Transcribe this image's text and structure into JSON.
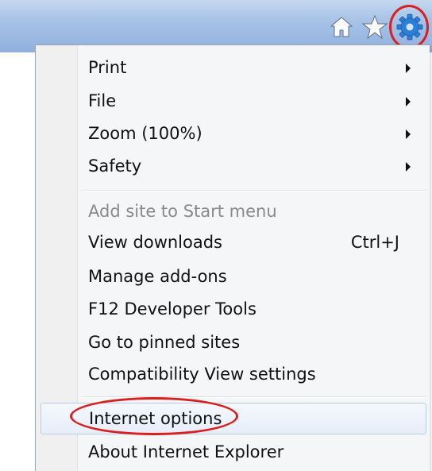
{
  "toolbar": {
    "icons": [
      "home-icon",
      "star-icon",
      "gear-icon"
    ]
  },
  "menu": {
    "items": [
      {
        "label": "Print",
        "submenu": true
      },
      {
        "label": "File",
        "submenu": true
      },
      {
        "label": "Zoom (100%)",
        "submenu": true
      },
      {
        "label": "Safety",
        "submenu": true
      },
      {
        "label": "Add site to Start menu",
        "disabled": true
      },
      {
        "label": "View downloads",
        "shortcut": "Ctrl+J"
      },
      {
        "label": "Manage add-ons"
      },
      {
        "label": "F12 Developer Tools"
      },
      {
        "label": "Go to pinned sites"
      },
      {
        "label": "Compatibility View settings"
      },
      {
        "label": "Internet options",
        "highlighted": true
      },
      {
        "label": "About Internet Explorer"
      }
    ]
  },
  "colors": {
    "highlight_ring": "#d92020",
    "disabled_text": "#8a8a8a",
    "gear_blue": "#2b7fd6"
  }
}
